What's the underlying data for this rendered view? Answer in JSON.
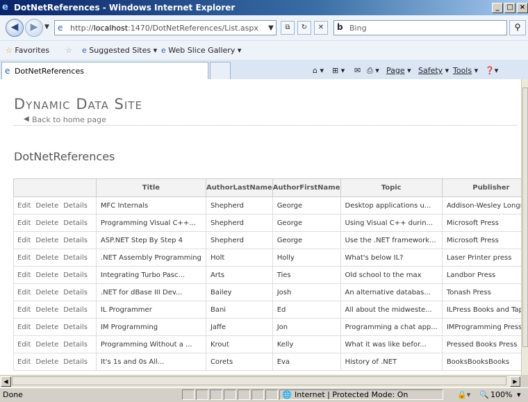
{
  "window": {
    "title": "DotNetReferences - Windows Internet Explorer"
  },
  "address": {
    "prefix": "http://",
    "host": "localhost",
    "rest": ":1470/DotNetReferences/List.aspx"
  },
  "search": {
    "placeholder": "Bing"
  },
  "favorites": {
    "label": "Favorites",
    "suggested": "Suggested Sites ▾",
    "webslice": "Web Slice Gallery ▾"
  },
  "tab": {
    "label": "DotNetReferences"
  },
  "commands": {
    "page": "Page",
    "safety": "Safety",
    "tools": "Tools"
  },
  "page": {
    "site_title": "Dynamic Data Site",
    "back_link": "Back to home page",
    "table_title": "DotNetReferences"
  },
  "grid": {
    "headers": [
      "Title",
      "AuthorLastName",
      "AuthorFirstName",
      "Topic",
      "Publisher"
    ],
    "actions": {
      "edit": "Edit",
      "delete": "Delete",
      "details": "Details"
    },
    "rows": [
      [
        "MFC Internals",
        "Shepherd",
        "George",
        "Desktop applications u...",
        "Addison-Wesley Longman"
      ],
      [
        "Programming Visual C++...",
        "Shepherd",
        "George",
        "Using Visual C++ durin...",
        "Microsoft Press"
      ],
      [
        "ASP.NET Step By Step 4",
        "Shepherd",
        "George",
        "Use the .NET framework...",
        "Microsoft Press"
      ],
      [
        ".NET Assembly Programming",
        "Holt",
        "Holly",
        "What's below IL?",
        "Laser Printer press"
      ],
      [
        "Integrating Turbo Pasc...",
        "Arts",
        "Ties",
        "Old school to the max",
        "Landbor Press"
      ],
      [
        ".NET for dBase III Dev...",
        "Bailey",
        "Josh",
        "An alternative databas...",
        "Tonash Press"
      ],
      [
        "IL Programmer",
        "Bani",
        "Ed",
        "All about the midweste...",
        "ILPress Books and Tapes"
      ],
      [
        "IM Programming",
        "Jaffe",
        "Jon",
        "Programming a chat app...",
        "IMProgramming Press"
      ],
      [
        "Programming Without a ...",
        "Krout",
        "Kelly",
        "What it was like befor...",
        "Pressed Books Press"
      ],
      [
        "It's 1s and 0s All...",
        "Corets",
        "Eva",
        "History of .NET",
        "BooksBooksBooks"
      ]
    ]
  },
  "status": {
    "left": "Done",
    "zone": "Internet | Protected Mode: On",
    "zoom": "100%"
  }
}
